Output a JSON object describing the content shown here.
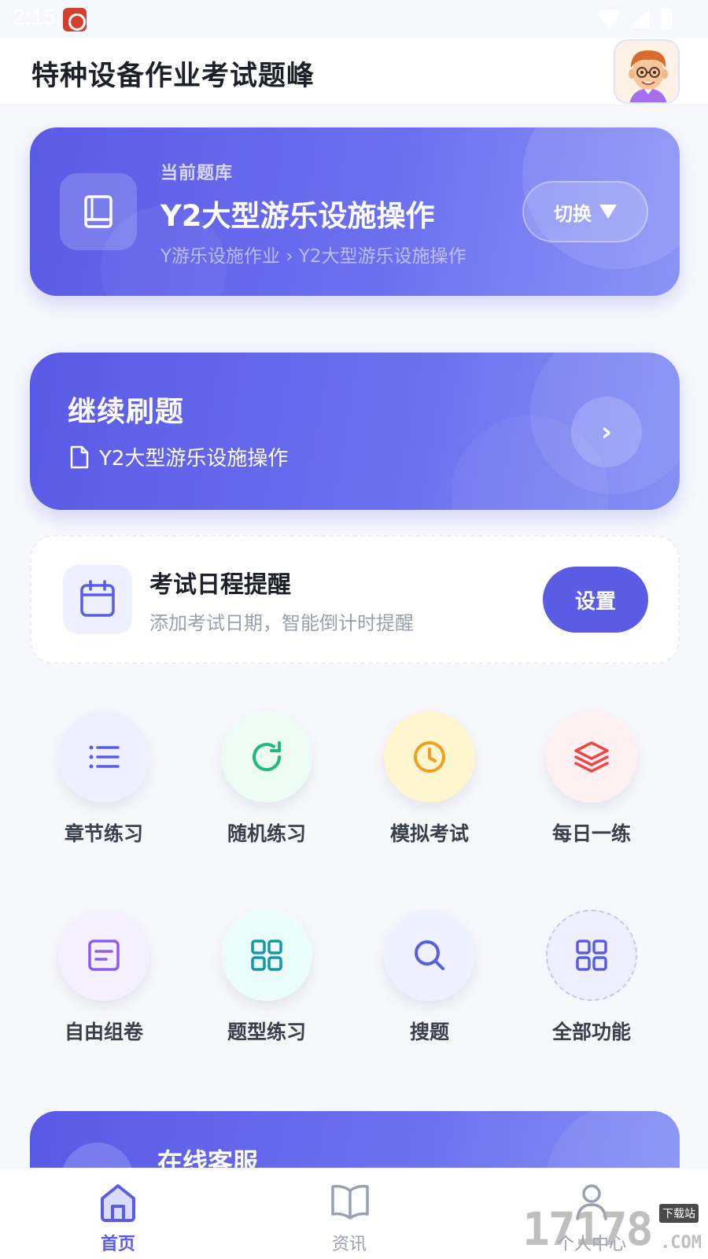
{
  "status_bar": {
    "time": "2:15"
  },
  "header": {
    "title": "特种设备作业考试题峰"
  },
  "question_bank": {
    "label": "当前题库",
    "name": "Y2大型游乐设施操作",
    "path": "Y游乐设施作业 › Y2大型游乐设施操作",
    "switch_label": "切换"
  },
  "continue_practice": {
    "title": "继续刷题",
    "subtitle": "Y2大型游乐设施操作",
    "arrow": "›"
  },
  "exam_reminder": {
    "title": "考试日程提醒",
    "description": "添加考试日期，智能倒计时提醒",
    "button_label": "设置"
  },
  "features": [
    {
      "label": "章节练习",
      "icon": "list-icon",
      "bg": "#eef0ff",
      "color": "#5b5ce6"
    },
    {
      "label": "随机练习",
      "icon": "refresh-icon",
      "bg": "#ecfbf4",
      "color": "#21b87f"
    },
    {
      "label": "模拟考试",
      "icon": "clock-icon",
      "bg": "#fff5cf",
      "color": "#f0a020"
    },
    {
      "label": "每日一练",
      "icon": "layers-icon",
      "bg": "#fff1f1",
      "color": "#ef4747"
    },
    {
      "label": "自由组卷",
      "icon": "document-icon",
      "bg": "#f5f0ff",
      "color": "#8a5cf0"
    },
    {
      "label": "题型练习",
      "icon": "grid-icon",
      "bg": "#eafcfb",
      "color": "#1697a6"
    },
    {
      "label": "搜题",
      "icon": "search-icon",
      "bg": "#eef1ff",
      "color": "#5b5ce6"
    },
    {
      "label": "全部功能",
      "icon": "apps-icon",
      "bg": "#eef0ff",
      "color": "#5b5ce6"
    }
  ],
  "service": {
    "title": "在线客服"
  },
  "bottom_nav": [
    {
      "label": "首页",
      "icon": "home-icon",
      "active": true
    },
    {
      "label": "资讯",
      "icon": "book-icon",
      "active": false
    },
    {
      "label": "个人中心",
      "icon": "user-icon",
      "active": false
    }
  ],
  "watermark": {
    "number": "17178",
    "badge": "下载站",
    "suffix": ".COM"
  },
  "colors": {
    "accent": "#5b5ce6",
    "text_dark": "#1d2029",
    "text_muted": "#9aa0ad"
  }
}
